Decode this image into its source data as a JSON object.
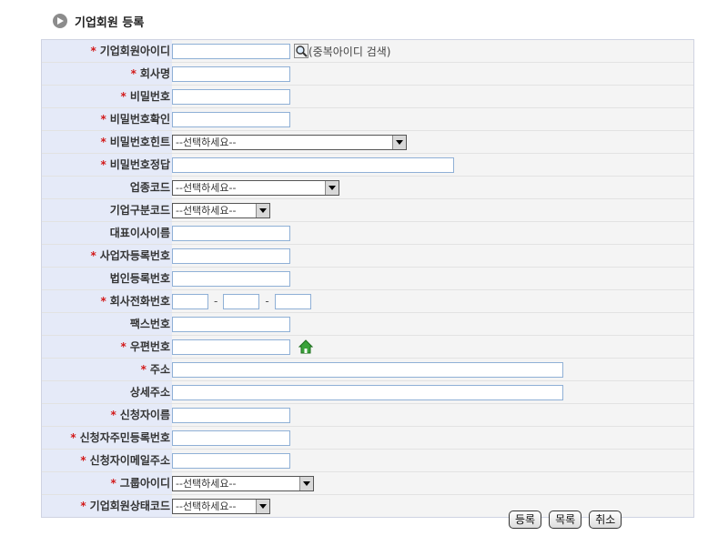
{
  "page": {
    "title": "기업회원 등록"
  },
  "form": {
    "labels": {
      "member_id": "기업회원아이디",
      "company_name": "회사명",
      "password": "비밀번호",
      "password_confirm": "비밀번호확인",
      "password_hint": "비밀번호힌트",
      "password_answer": "비밀번호정답",
      "industry_code": "업종코드",
      "company_type_code": "기업구분코드",
      "ceo_name": "대표이사이름",
      "business_reg_no": "사업자등록번호",
      "corp_reg_no": "법인등록번호",
      "company_phone": "회사전화번호",
      "fax": "팩스번호",
      "zip_code": "우편번호",
      "address": "주소",
      "address_detail": "상세주소",
      "applicant_name": "신청자이름",
      "applicant_rrn": "신청자주민등록번호",
      "applicant_email": "신청자이메일주소",
      "group_id": "그룹아이디",
      "status_code": "기업회원상태코드"
    },
    "required_mark": "*",
    "id_check_hint": "(중복아이디 검색)",
    "phone_separator": "-",
    "select_placeholder": "--선택하세요--"
  },
  "buttons": {
    "register": "등록",
    "list": "목록",
    "cancel": "취소"
  },
  "icons": {
    "id_search": "magnifier-icon",
    "zip_search": "home-icon",
    "title_bullet": "arrow-circle-icon"
  },
  "colors": {
    "label_bg": "#e5eaf8",
    "row_bg": "#f4f4f4",
    "required": "#d21a1a",
    "input_border": "#8fb0d6"
  }
}
